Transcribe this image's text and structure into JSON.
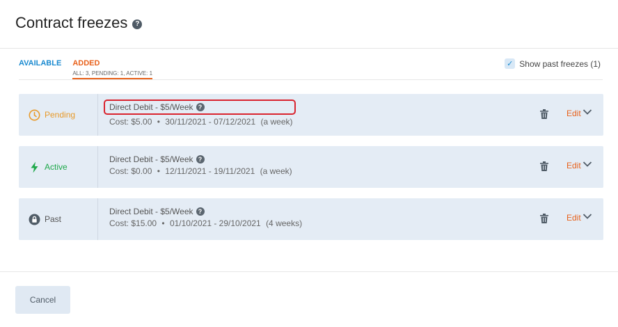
{
  "header": {
    "title": "Contract freezes",
    "help_icon": "question-circle-icon"
  },
  "tabs": {
    "available": "AVAILABLE",
    "added": "ADDED",
    "added_counts": "ALL: 3, PENDING: 1, ACTIVE: 1"
  },
  "show_past": {
    "label": "Show past freezes (1)",
    "checked": true
  },
  "freezes": [
    {
      "status": "Pending",
      "status_icon": "clock-icon",
      "status_color": "#e89a2a",
      "name": "Direct Debit - $5/Week",
      "cost": "Cost: $5.00",
      "dates": "30/11/2021 -  07/12/2021",
      "duration": "(a week)",
      "edit": "Edit"
    },
    {
      "status": "Active",
      "status_icon": "lightning-icon",
      "status_color": "#1ea84a",
      "name": "Direct Debit - $5/Week",
      "cost": "Cost: $0.00",
      "dates": "12/11/2021 -  19/11/2021",
      "duration": "(a week)",
      "edit": "Edit"
    },
    {
      "status": "Past",
      "status_icon": "lock-icon",
      "status_color": "#555555",
      "name": "Direct Debit - $5/Week",
      "cost": "Cost: $15.00",
      "dates": "01/10/2021 -  29/10/2021",
      "duration": "(4 weeks)",
      "edit": "Edit"
    }
  ],
  "footer": {
    "cancel": "Cancel"
  }
}
